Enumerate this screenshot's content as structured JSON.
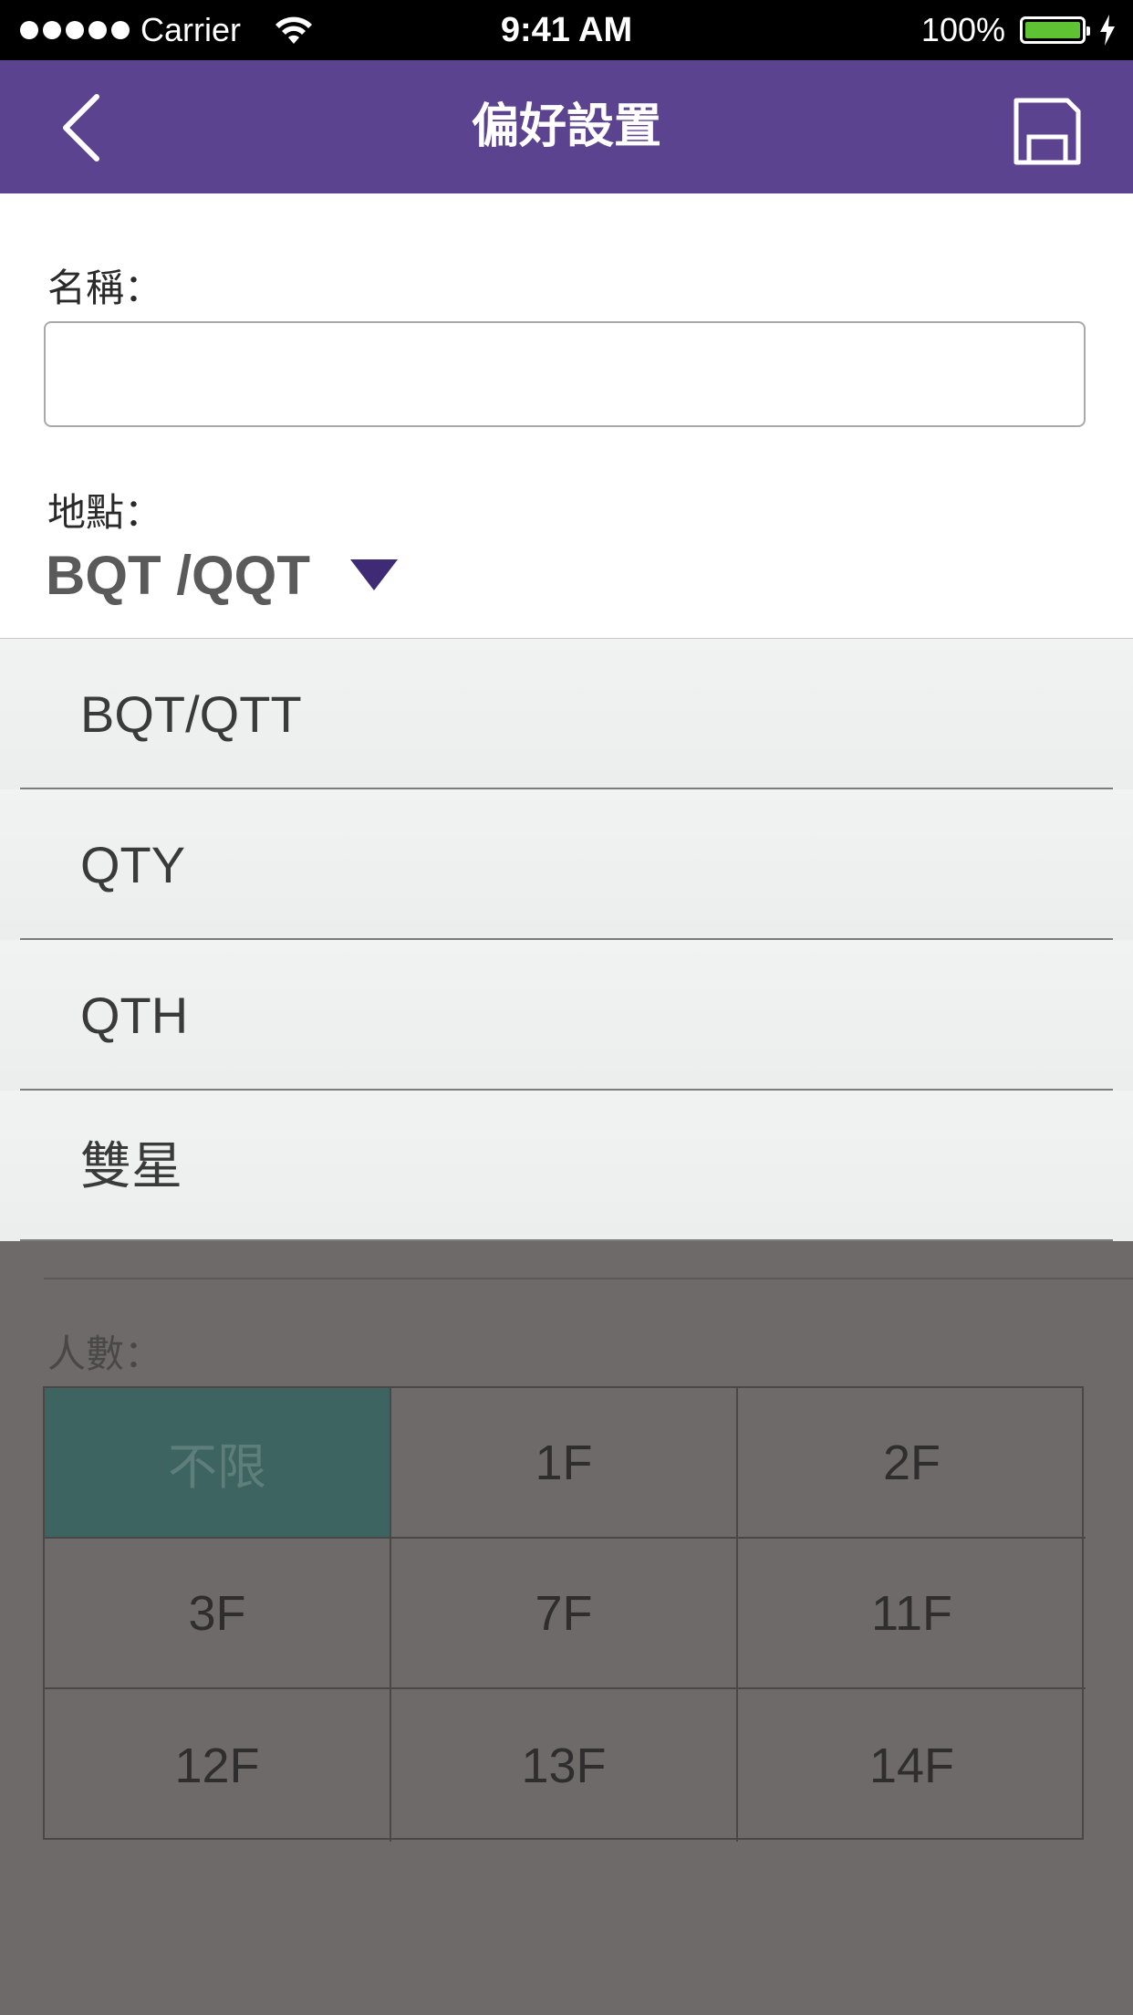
{
  "status_bar": {
    "carrier": "Carrier",
    "time": "9:41 AM",
    "battery": "100%",
    "battery_color": "#5ec233"
  },
  "nav": {
    "title": "偏好設置",
    "back_icon": "chevron-left-icon",
    "save_icon": "floppy-disk-icon",
    "background": "#5c4390"
  },
  "form": {
    "name_label": "名稱：",
    "name_value": "",
    "location_label": "地點：",
    "location_value": "BQT /QQT",
    "people_label": "人數："
  },
  "dropdown": {
    "options": [
      "BQT/QTT",
      "QTY",
      "QTH",
      "雙星"
    ]
  },
  "grid": {
    "cells": [
      [
        "不限",
        "1F",
        "2F"
      ],
      [
        "3F",
        "7F",
        "11F"
      ],
      [
        "12F",
        "13F",
        "14F"
      ]
    ],
    "selected": "不限",
    "selected_color": "#3e6461"
  }
}
